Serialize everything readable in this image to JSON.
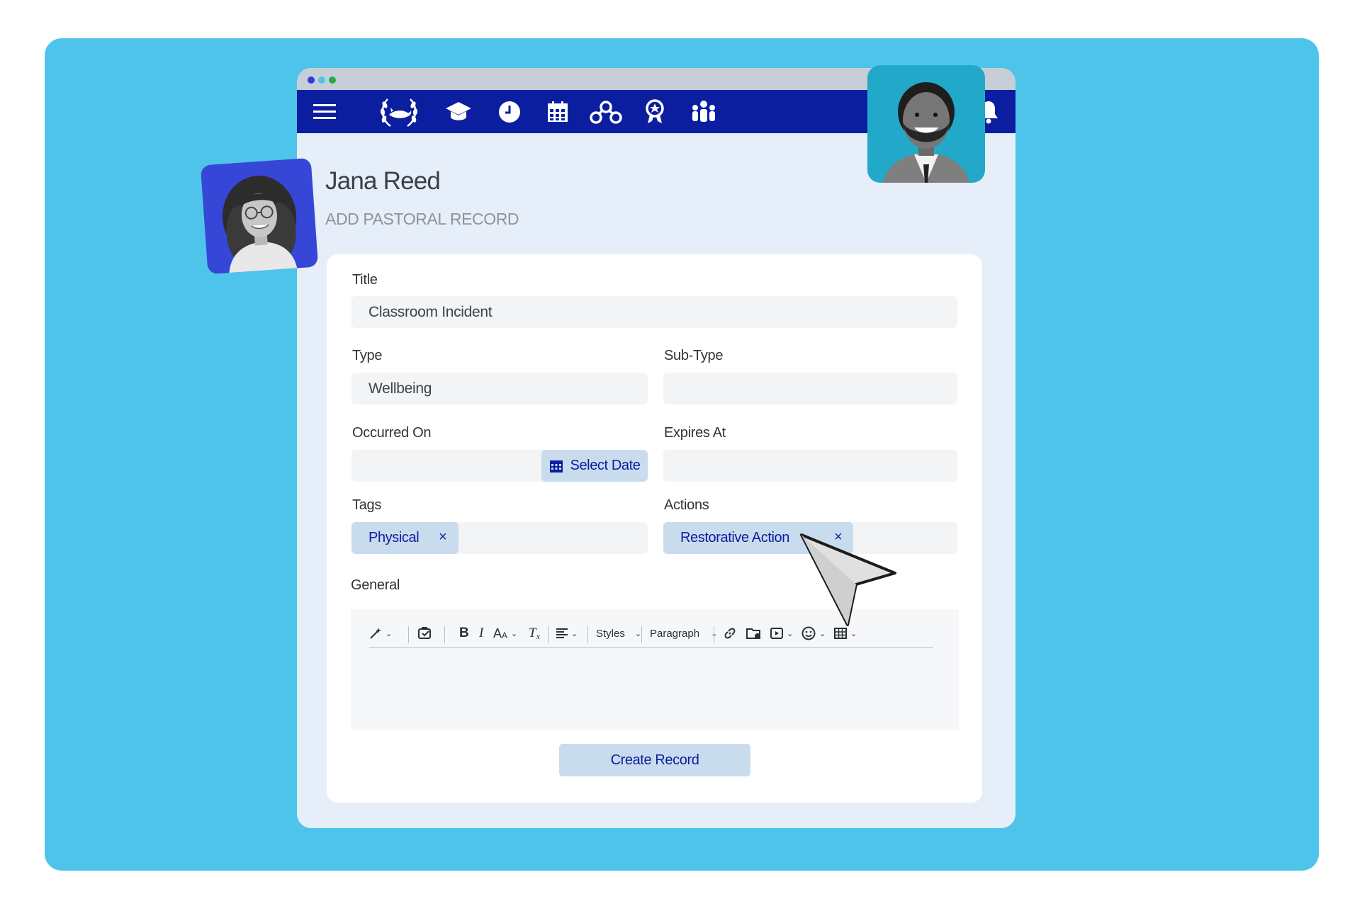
{
  "colors": {
    "background": "#4ec4ea",
    "navbar": "#0b1e9f",
    "window": "#e6eef9",
    "accent_chip": "#c9dcee",
    "avatar_left_bg": "#3646d6",
    "avatar_right_bg": "#22a9c9"
  },
  "window_dots": [
    "#2d3fd8",
    "#4ec4ea",
    "#2aa84a"
  ],
  "nav": {
    "icons": [
      "menu-icon",
      "school-crest-logo",
      "graduation-cap-icon",
      "clock-icon",
      "calendar-icon",
      "network-icon",
      "award-icon",
      "people-icon",
      "bell-icon"
    ]
  },
  "header": {
    "person_name": "Jana Reed",
    "page_subtitle": "ADD PASTORAL RECORD"
  },
  "form": {
    "title_label": "Title",
    "title_value": "Classroom Incident",
    "type_label": "Type",
    "type_value": "Wellbeing",
    "subtype_label": "Sub-Type",
    "subtype_value": "",
    "occurred_label": "Occurred On",
    "select_date_label": "Select Date",
    "expires_label": "Expires At",
    "expires_value": "",
    "tags_label": "Tags",
    "tags": [
      "Physical"
    ],
    "actions_label": "Actions",
    "actions": [
      "Restorative Action"
    ],
    "remove_symbol": "×",
    "general_label": "General",
    "editor_toolbar": {
      "styles_label": "Styles",
      "paragraph_label": "Paragraph",
      "font_size_label": "A",
      "font_size_sub": "A",
      "clear_format_label": "T",
      "clear_format_sub": "x"
    },
    "create_button_label": "Create Record"
  }
}
